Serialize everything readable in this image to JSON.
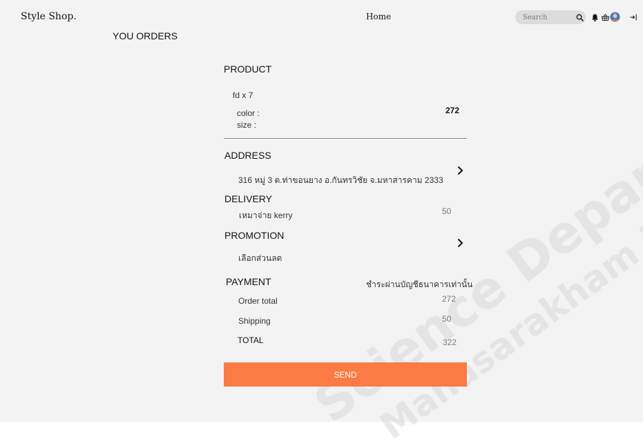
{
  "header": {
    "brand": "Style Shop.",
    "nav_home": "Home",
    "search_placeholder": "Search"
  },
  "page_title": "YOU ORDERS",
  "product": {
    "heading": "PRODUCT",
    "item": "fd x 7",
    "color_label": "color :",
    "size_label": "size :",
    "price": "272"
  },
  "address": {
    "heading": "ADDRESS",
    "value": "316  หมู่ 3 ต.ท่าขอนยาง อ.กันทรวิชัย จ.มหาสารคาม 2333"
  },
  "delivery": {
    "heading": "DELIVERY",
    "method": "เหมาจ่าย  kerry",
    "cost": "50"
  },
  "promotion": {
    "heading": "PROMOTION",
    "value": "เลือกส่วนลด"
  },
  "payment": {
    "heading": "PAYMENT",
    "method": "ชำระผ่านบัญชีธนาคารเท่านั้น",
    "order_total_label": "Order total",
    "order_total": "272",
    "shipping_label": "Shipping",
    "shipping": "50",
    "total_label": "TOTAL",
    "total": "322"
  },
  "send_label": "SEND",
  "watermark": {
    "line1": "Science Department",
    "line2": "Mahasarakham University"
  },
  "colors": {
    "accent": "#fa7b43",
    "page_background": "#f3f3f3",
    "search_background": "#dcdcdc"
  },
  "icons": [
    "search-icon",
    "bell-icon",
    "basket-icon",
    "avatar-icon",
    "logout-icon",
    "chevron-right-icon"
  ]
}
